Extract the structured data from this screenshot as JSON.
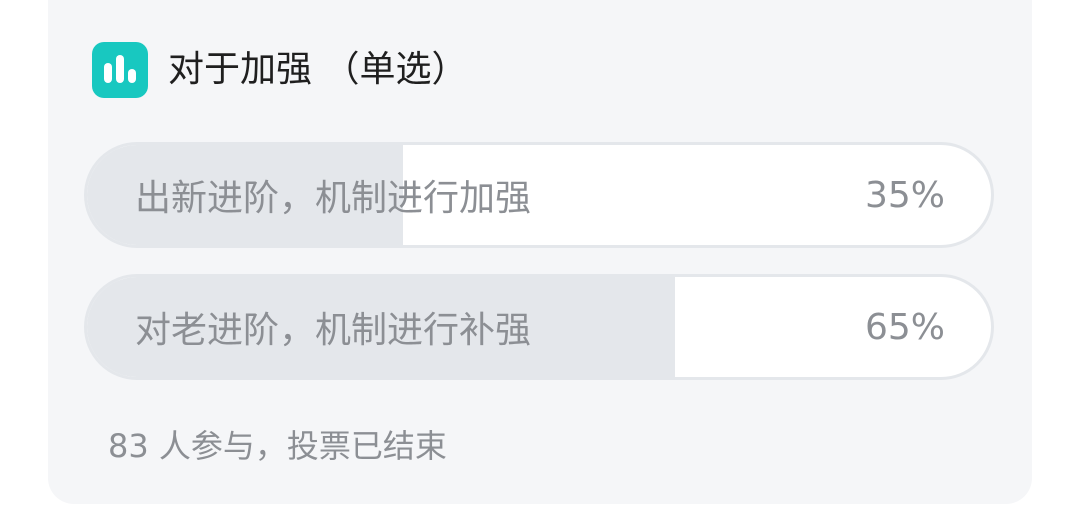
{
  "poll": {
    "title": "对于加强 （单选）",
    "icon": "poll-chart-icon",
    "accent_color": "#18c8c0",
    "options": [
      {
        "label": "出新进阶，机制进行加强",
        "percent_text": "35%",
        "percent": 35
      },
      {
        "label": "对老进阶，机制进行补强",
        "percent_text": "65%",
        "percent": 65
      }
    ],
    "footer": "83 人参与，投票已结束"
  }
}
